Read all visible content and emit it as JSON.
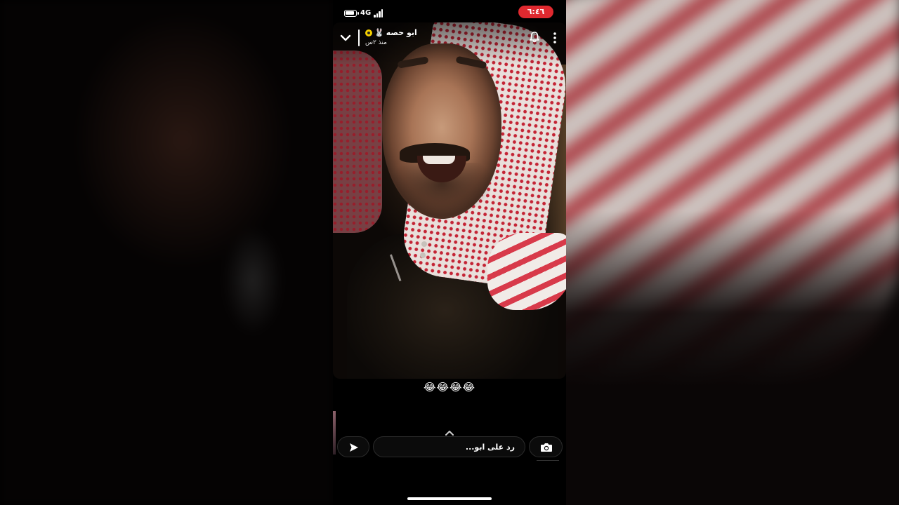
{
  "status_bar": {
    "network": "4G",
    "time": "٦:٤٦",
    "battery_icon": "battery-icon",
    "signal_icon": "signal-bars-icon"
  },
  "story_header": {
    "user_name": "ابو حصه",
    "emoji": "🐰",
    "time_ago": "منذ ٢س",
    "icons": [
      "chevron-down-icon",
      "bell-icon",
      "more-vertical-icon"
    ]
  },
  "caption": "😂😂😂😂",
  "reply_bar": {
    "placeholder": "رد على ابو...",
    "send_icon": "send-icon",
    "camera_icon": "camera-icon"
  },
  "colors": {
    "time_pill": "#e0292f",
    "story_ring": "#f5d000",
    "background": "#000000"
  }
}
